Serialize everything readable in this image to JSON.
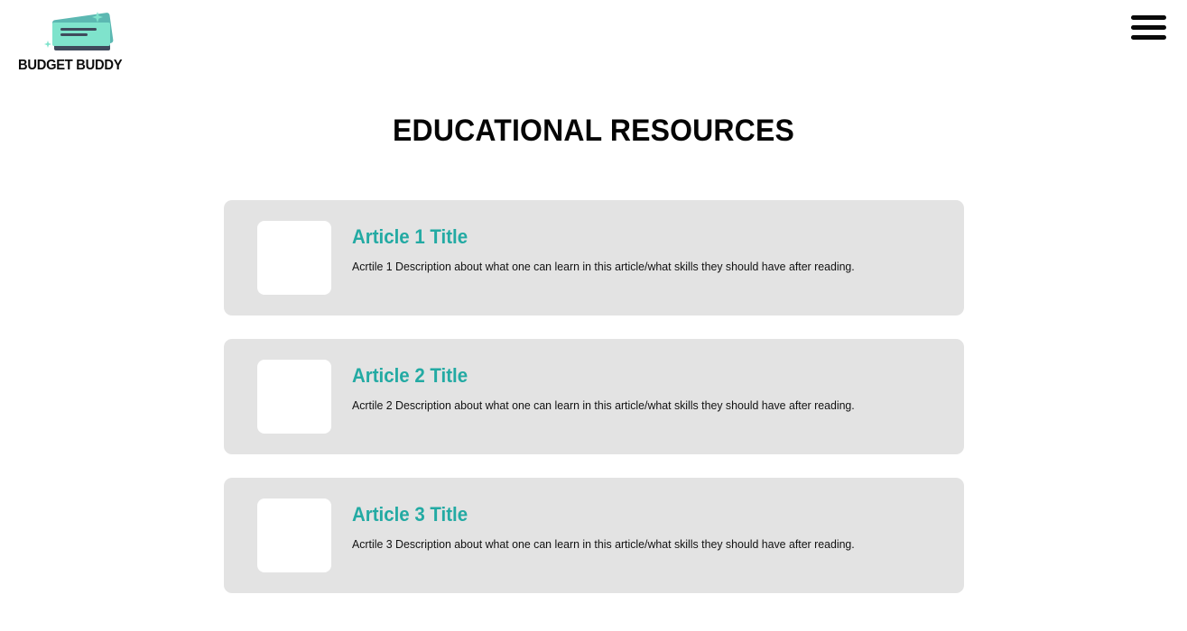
{
  "header": {
    "logo_text": "BUDGET BUDDY",
    "menu_icon": "hamburger-menu-icon"
  },
  "main": {
    "title": "EDUCATIONAL RESOURCES",
    "articles": [
      {
        "title": "Article 1 Title",
        "description": "Acrtile 1 Description about what one can learn in this article/what skills they should have after reading."
      },
      {
        "title": "Article 2 Title",
        "description": "Acrtile 2 Description about what one can learn in this article/what skills they should have after reading."
      },
      {
        "title": "Article 3 Title",
        "description": "Acrtile 3 Description about what one can learn in this article/what skills they should have after reading."
      }
    ]
  },
  "colors": {
    "accent": "#23aaa3",
    "card_background": "#e3e3e3",
    "logo_teal_light": "#7fe3cc",
    "logo_teal_dark": "#5cb8b2",
    "logo_slate": "#3f4a5c"
  }
}
